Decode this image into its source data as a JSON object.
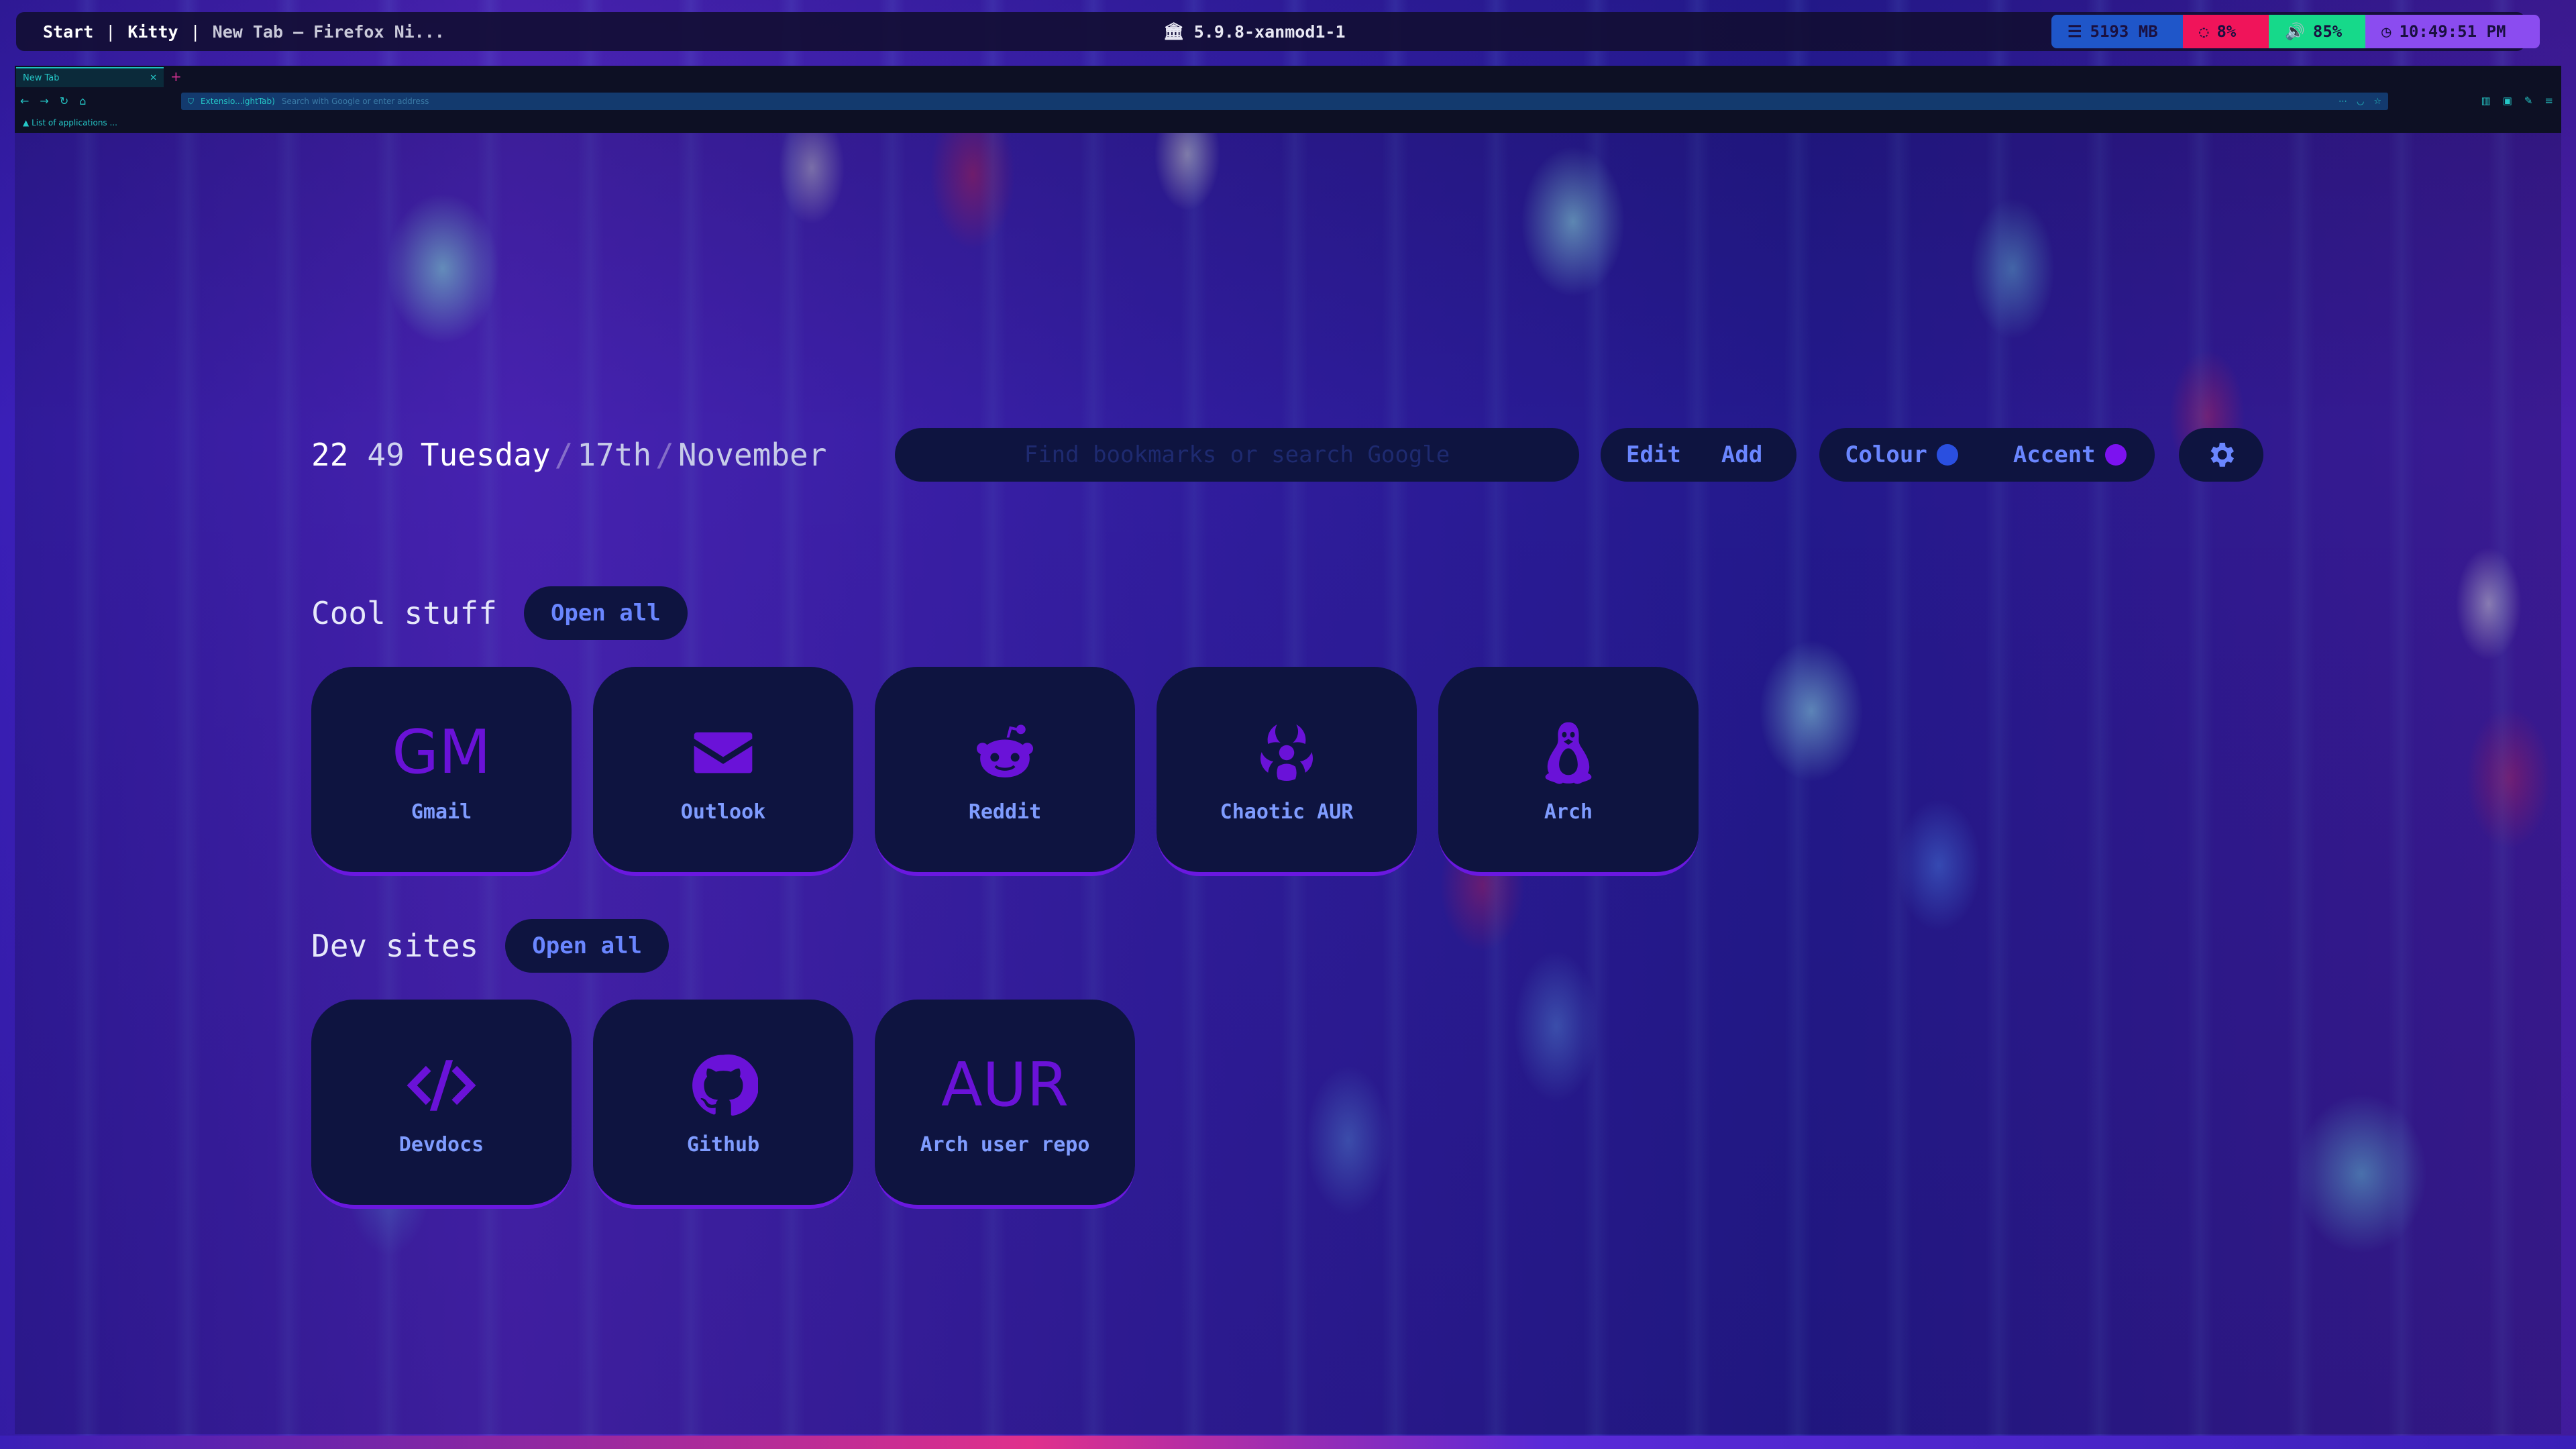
{
  "desktop": {
    "workspaces": [
      "Start",
      "Kitty"
    ],
    "window_title": "New Tab — Firefox Ni...",
    "kernel": "5.9.8-xanmod1-1",
    "memory": "5193 MB",
    "cpu": "8%",
    "volume": "85%",
    "clock": "10:49:51 PM",
    "module_colors": {
      "memory": "#1f56c9",
      "cpu": "#f0145a",
      "volume": "#16d98a",
      "clock": "#8b4cf0"
    }
  },
  "browser": {
    "tab_title": "New Tab",
    "url_extension_label": "Extensio...ightTab)",
    "url_placeholder": "Search with Google or enter address",
    "bookmark": "List of applications ..."
  },
  "startpage": {
    "time_hour": "22",
    "time_minute": "49",
    "weekday": "Tuesday",
    "date": "17th",
    "month": "November",
    "search_placeholder": "Find bookmarks or search Google",
    "edit_label": "Edit",
    "add_label": "Add",
    "colour_label": "Colour",
    "accent_label": "Accent",
    "colour_value": "#2a4fe0",
    "accent_value": "#7c12f0",
    "sections": [
      {
        "title": "Cool stuff",
        "open_all": "Open all",
        "links": [
          {
            "label": "Gmail",
            "icon": "GM"
          },
          {
            "label": "Outlook",
            "icon": "envelope-icon"
          },
          {
            "label": "Reddit",
            "icon": "reddit-icon"
          },
          {
            "label": "Chaotic AUR",
            "icon": "biohazard-icon"
          },
          {
            "label": "Arch",
            "icon": "linux-tux-icon"
          }
        ]
      },
      {
        "title": "Dev sites",
        "open_all": "Open all",
        "links": [
          {
            "label": "Devdocs",
            "icon": "code-icon"
          },
          {
            "label": "Github",
            "icon": "github-icon"
          },
          {
            "label": "Arch user repo",
            "icon": "AUR"
          }
        ]
      }
    ]
  }
}
